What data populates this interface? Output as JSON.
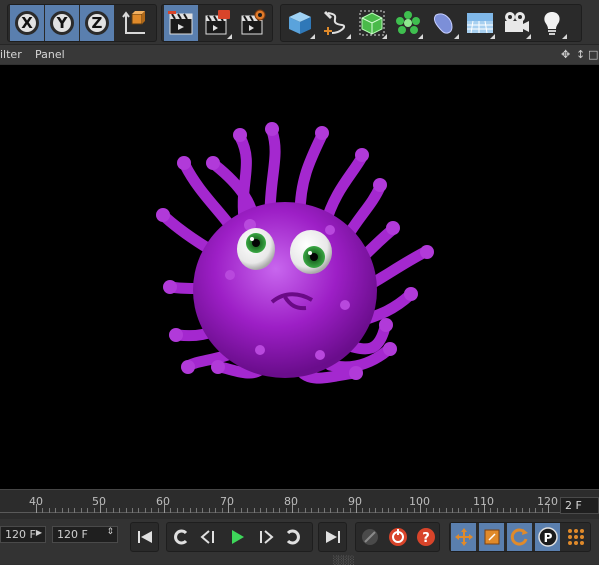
{
  "toolbar": {
    "axis_buttons": [
      "X",
      "Y",
      "Z"
    ],
    "icons": [
      "coordinate-system-icon",
      "render-view-icon",
      "render-to-picture-viewer-icon",
      "render-settings-icon",
      "cube-icon",
      "spline-pen-icon",
      "subdivision-cage-icon",
      "cloner-icon",
      "deformer-icon",
      "floor-icon",
      "camera-icon",
      "light-icon"
    ]
  },
  "menubar": {
    "items": [
      "ilter",
      "Panel"
    ],
    "controls": [
      "✥",
      "↕",
      "□"
    ]
  },
  "timeline": {
    "tick_labels": [
      "40",
      "50",
      "60",
      "70",
      "80",
      "90",
      "100",
      "110",
      "120"
    ],
    "current_frame": "2 F"
  },
  "transport": {
    "start_field": "120 F",
    "end_field": "120 F"
  },
  "colors": {
    "active_blue": "#5a7fae",
    "object_purple": "#a020c8",
    "eye_green": "#2c8a34",
    "record_red": "#d8442a",
    "key_orange": "#e08a2a"
  }
}
